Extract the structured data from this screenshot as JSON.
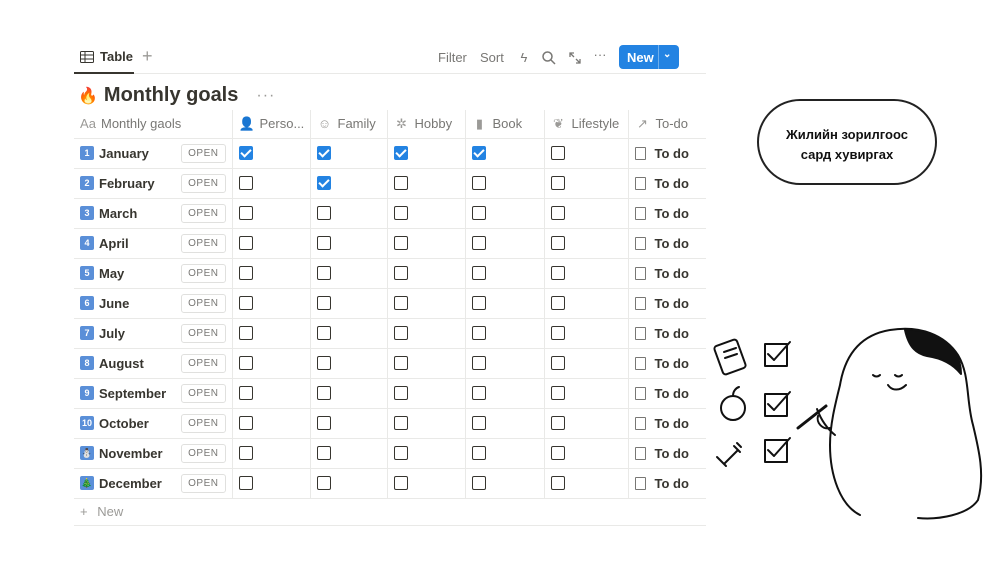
{
  "view": {
    "tab_label": "Table",
    "add_view": "+"
  },
  "toolbar": {
    "filter": "Filter",
    "sort": "Sort",
    "new_label": "New"
  },
  "page": {
    "emoji": "🔥",
    "title": "Monthly goals",
    "more": "···"
  },
  "columns": [
    {
      "icon": "Aa",
      "label": "Monthly gaols"
    },
    {
      "icon": "person-icon",
      "label": "Perso..."
    },
    {
      "icon": "smile-icon",
      "label": "Family"
    },
    {
      "icon": "hobby-icon",
      "label": "Hobby"
    },
    {
      "icon": "book-icon",
      "label": "Book"
    },
    {
      "icon": "lifestyle-icon",
      "label": "Lifestyle"
    },
    {
      "icon": "relation-arrow-icon",
      "label": "To-do"
    }
  ],
  "open_label": "OPEN",
  "todo_label": "To do",
  "rows": [
    {
      "badge": "1",
      "name": "January",
      "checks": [
        true,
        true,
        true,
        true,
        false
      ]
    },
    {
      "badge": "2",
      "name": "February",
      "checks": [
        false,
        true,
        false,
        false,
        false
      ]
    },
    {
      "badge": "3",
      "name": "March",
      "checks": [
        false,
        false,
        false,
        false,
        false
      ]
    },
    {
      "badge": "4",
      "name": "April",
      "checks": [
        false,
        false,
        false,
        false,
        false
      ]
    },
    {
      "badge": "5",
      "name": "May",
      "checks": [
        false,
        false,
        false,
        false,
        false
      ]
    },
    {
      "badge": "6",
      "name": "June",
      "checks": [
        false,
        false,
        false,
        false,
        false
      ]
    },
    {
      "badge": "7",
      "name": "July",
      "checks": [
        false,
        false,
        false,
        false,
        false
      ]
    },
    {
      "badge": "8",
      "name": "August",
      "checks": [
        false,
        false,
        false,
        false,
        false
      ]
    },
    {
      "badge": "9",
      "name": "September",
      "checks": [
        false,
        false,
        false,
        false,
        false
      ]
    },
    {
      "badge": "10",
      "name": "October",
      "checks": [
        false,
        false,
        false,
        false,
        false
      ]
    },
    {
      "badge": "⛄",
      "name": "November",
      "checks": [
        false,
        false,
        false,
        false,
        false
      ]
    },
    {
      "badge": "🎄",
      "name": "December",
      "checks": [
        false,
        false,
        false,
        false,
        false
      ]
    }
  ],
  "add_row": "New",
  "bubble": {
    "line1": "Жилийн зорилгоос",
    "line2": "сард хувиргах"
  },
  "colors": {
    "accent": "#2383e2",
    "text": "#37352f",
    "muted": "#787774"
  }
}
